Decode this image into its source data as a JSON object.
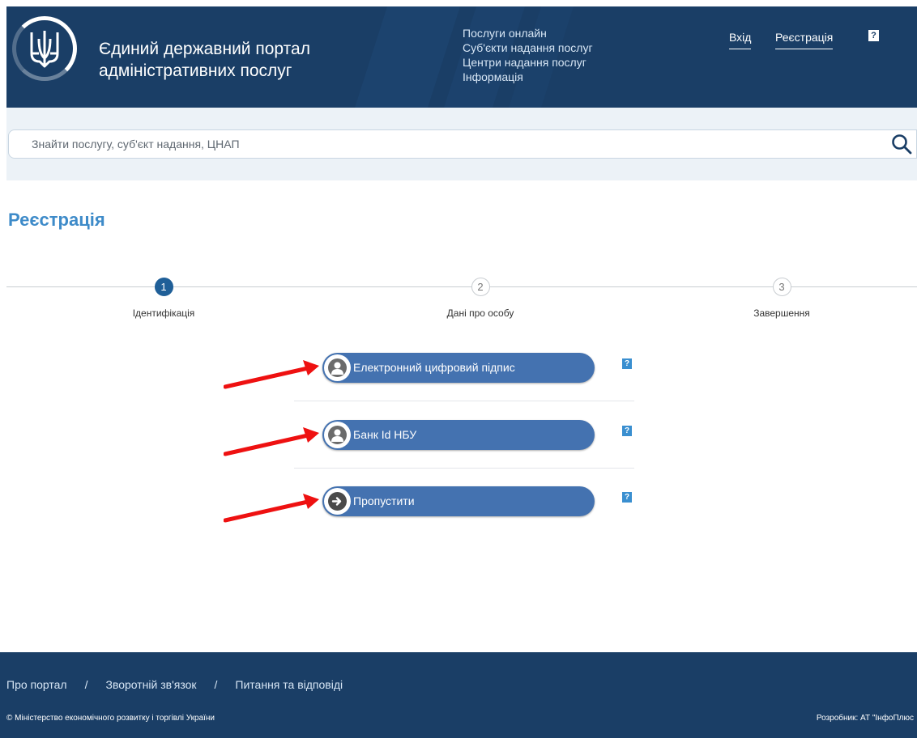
{
  "header": {
    "title_line1": "Єдиний державний портал",
    "title_line2": "адміністративних послуг",
    "nav": [
      "Послуги онлайн",
      "Суб'єкти надання послуг",
      "Центри надання послуг",
      "Інформація"
    ],
    "login": "Вхід",
    "register": "Реєстрація",
    "help": "?",
    "logo_icon": "tryzub-icon"
  },
  "search": {
    "placeholder": "Знайти послугу, суб'єкт надання, ЦНАП",
    "icon": "search-icon"
  },
  "page_title": "Реєстрація",
  "stepper": {
    "steps": [
      {
        "number": "1",
        "label": "Ідентифікація"
      },
      {
        "number": "2",
        "label": "Дані про особу"
      },
      {
        "number": "3",
        "label": "Завершення"
      }
    ],
    "active_step": 1
  },
  "options": [
    {
      "label": "Електронний цифровий підпис",
      "icon": "user-icon",
      "help": "?"
    },
    {
      "label": "Банк Id НБУ",
      "icon": "user-icon",
      "help": "?"
    },
    {
      "label": "Пропустити",
      "icon": "arrow-right-icon",
      "help": "?"
    }
  ],
  "footer": {
    "links": [
      "Про портал",
      "Зворотній зв'язок",
      "Питання та відповіді"
    ],
    "separator": "/",
    "copyright": "© Міністерство економічного розвитку і торгівлі України",
    "developer": "Розробник: АТ \"ІнфоПлюс"
  },
  "colors": {
    "header_bg": "#1a3e66",
    "accent": "#3e8bc9",
    "button": "#4472b0",
    "search_band": "#ecf2f7",
    "annotation_arrow": "#ee1111"
  }
}
